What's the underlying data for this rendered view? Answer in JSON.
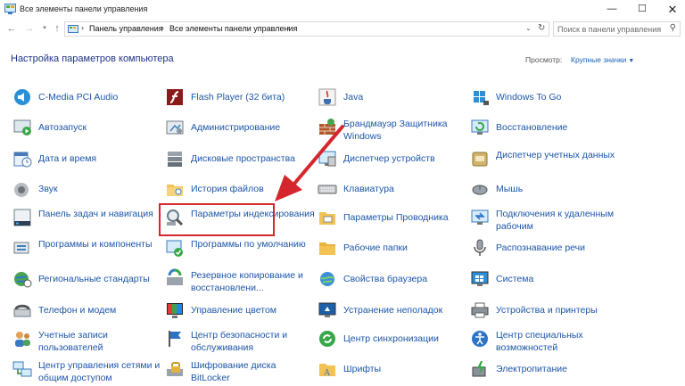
{
  "window": {
    "title": "Все элементы панели управления"
  },
  "address_bar": {
    "crumbs": [
      "Панель управления",
      "Все элементы панели управления"
    ]
  },
  "search": {
    "placeholder": "Поиск в панели управления"
  },
  "header": {
    "title": "Настройка параметров компьютера",
    "view_by_label": "Просмотр:",
    "view_by_value": "Крупные значки"
  },
  "colors": {
    "link": "#1c55a8",
    "title": "#1e3287",
    "highlight": "#d6262d"
  },
  "items": {
    "col1": [
      {
        "label": "C-Media PCI Audio",
        "icon": "speaker-icon"
      },
      {
        "label": "Автозапуск",
        "icon": "autoplay-icon"
      },
      {
        "label": "Дата и время",
        "icon": "calendar-clock-icon"
      },
      {
        "label": "Звук",
        "icon": "sound-icon"
      },
      {
        "label": "Панель задач и навигация",
        "icon": "taskbar-icon"
      },
      {
        "label": "Программы и компоненты",
        "icon": "programs-icon"
      },
      {
        "label": "Региональные стандарты",
        "icon": "globe-clock-icon"
      },
      {
        "label": "Телефон и модем",
        "icon": "phone-modem-icon"
      },
      {
        "label": "Учетные записи пользователей",
        "icon": "users-icon"
      },
      {
        "label": "Центр управления сетями и общим доступом",
        "icon": "network-icon"
      }
    ],
    "col2": [
      {
        "label": "Flash Player (32 бита)",
        "icon": "flash-icon"
      },
      {
        "label": "Администрирование",
        "icon": "admin-tools-icon"
      },
      {
        "label": "Дисковые пространства",
        "icon": "storage-spaces-icon"
      },
      {
        "label": "История файлов",
        "icon": "file-history-icon"
      },
      {
        "label": "Параметры индексирования",
        "icon": "indexing-icon"
      },
      {
        "label": "Программы по умолчанию",
        "icon": "default-programs-icon"
      },
      {
        "label": "Резервное копирование и восстановлени...",
        "icon": "backup-icon"
      },
      {
        "label": "Управление цветом",
        "icon": "color-management-icon"
      },
      {
        "label": "Центр безопасности и обслуживания",
        "icon": "flag-icon"
      },
      {
        "label": "Шифрование диска BitLocker",
        "icon": "bitlocker-icon"
      }
    ],
    "col3": [
      {
        "label": "Java",
        "icon": "java-icon"
      },
      {
        "label": "Брандмауэр Защитника Windows",
        "icon": "firewall-icon"
      },
      {
        "label": "Диспетчер устройств",
        "icon": "device-manager-icon"
      },
      {
        "label": "Клавиатура",
        "icon": "keyboard-icon"
      },
      {
        "label": "Параметры Проводника",
        "icon": "folder-options-icon"
      },
      {
        "label": "Рабочие папки",
        "icon": "work-folders-icon"
      },
      {
        "label": "Свойства браузера",
        "icon": "internet-options-icon"
      },
      {
        "label": "Устранение неполадок",
        "icon": "troubleshooting-icon"
      },
      {
        "label": "Центр синхронизации",
        "icon": "sync-center-icon"
      },
      {
        "label": "Шрифты",
        "icon": "fonts-icon"
      }
    ],
    "col4": [
      {
        "label": "Windows To Go",
        "icon": "windows-to-go-icon"
      },
      {
        "label": "Восстановление",
        "icon": "recovery-icon"
      },
      {
        "label": "Диспетчер учетных данных",
        "icon": "credential-manager-icon"
      },
      {
        "label": "Мышь",
        "icon": "mouse-icon"
      },
      {
        "label": "Подключения к удаленным рабочим",
        "icon": "remote-desktop-icon"
      },
      {
        "label": "Распознавание речи",
        "icon": "microphone-icon"
      },
      {
        "label": "Система",
        "icon": "system-icon"
      },
      {
        "label": "Устройства и принтеры",
        "icon": "printer-icon"
      },
      {
        "label": "Центр специальных возможностей",
        "icon": "ease-of-access-icon"
      },
      {
        "label": "Электропитание",
        "icon": "power-options-icon"
      }
    ]
  }
}
